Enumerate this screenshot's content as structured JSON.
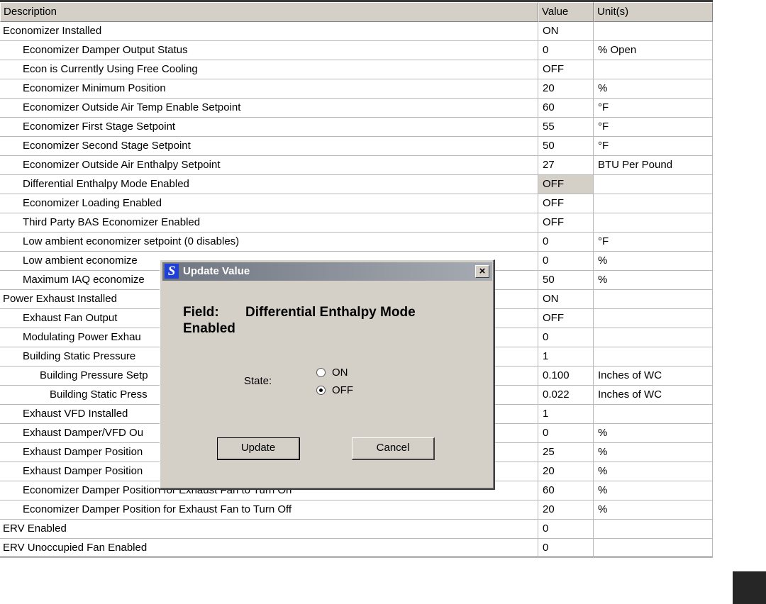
{
  "table": {
    "headers": [
      "Description",
      "Value",
      "Unit(s)"
    ],
    "rows": [
      {
        "desc": "Economizer Installed",
        "indent": 0,
        "value": "ON",
        "unit": ""
      },
      {
        "desc": "Economizer Damper Output Status",
        "indent": 1,
        "value": "0",
        "unit": "% Open"
      },
      {
        "desc": "Econ is Currently Using Free Cooling",
        "indent": 1,
        "value": "OFF",
        "unit": ""
      },
      {
        "desc": "Economizer Minimum Position",
        "indent": 1,
        "value": "20",
        "unit": "%"
      },
      {
        "desc": "Economizer Outside Air Temp Enable Setpoint",
        "indent": 1,
        "value": "60",
        "unit": "°F"
      },
      {
        "desc": "Economizer First Stage Setpoint",
        "indent": 1,
        "value": "55",
        "unit": "°F"
      },
      {
        "desc": "Economizer Second Stage Setpoint",
        "indent": 1,
        "value": "50",
        "unit": "°F"
      },
      {
        "desc": "Economizer Outside Air Enthalpy Setpoint",
        "indent": 1,
        "value": "27",
        "unit": "BTU Per Pound"
      },
      {
        "desc": "Differential Enthalpy Mode Enabled",
        "indent": 1,
        "value": "OFF",
        "unit": "",
        "selected": true
      },
      {
        "desc": "Economizer Loading Enabled",
        "indent": 1,
        "value": "OFF",
        "unit": ""
      },
      {
        "desc": "Third Party BAS Economizer Enabled",
        "indent": 1,
        "value": "OFF",
        "unit": ""
      },
      {
        "desc": "Low ambient economizer setpoint (0 disables)",
        "indent": 1,
        "value": "0",
        "unit": "°F"
      },
      {
        "desc": "Low ambient economize",
        "indent": 1,
        "value": "0",
        "unit": "%"
      },
      {
        "desc": "Maximum IAQ economize",
        "indent": 1,
        "value": "50",
        "unit": "%"
      },
      {
        "desc": "Power Exhaust Installed",
        "indent": 0,
        "value": "ON",
        "unit": ""
      },
      {
        "desc": "Exhaust Fan Output",
        "indent": 1,
        "value": "OFF",
        "unit": ""
      },
      {
        "desc": "Modulating Power Exhau",
        "indent": 1,
        "value": "0",
        "unit": ""
      },
      {
        "desc": "Building Static Pressure",
        "indent": 1,
        "value": "1",
        "unit": ""
      },
      {
        "desc": "Building Pressure Setp",
        "indent": 2,
        "value": "0.100",
        "unit": "Inches of WC"
      },
      {
        "desc": "Building Static Press",
        "indent": 3,
        "value": "0.022",
        "unit": "Inches of WC"
      },
      {
        "desc": "Exhaust VFD Installed",
        "indent": 1,
        "value": "1",
        "unit": ""
      },
      {
        "desc": "Exhaust Damper/VFD Ou",
        "indent": 1,
        "value": "0",
        "unit": "%"
      },
      {
        "desc": "Exhaust Damper Position",
        "indent": 1,
        "value": "25",
        "unit": "%"
      },
      {
        "desc": "Exhaust Damper Position",
        "indent": 1,
        "value": "20",
        "unit": "%"
      },
      {
        "desc": "Economizer Damper Position for Exhaust Fan to Turn On",
        "indent": 1,
        "value": "60",
        "unit": "%"
      },
      {
        "desc": "Economizer Damper Position for Exhaust Fan to Turn Off",
        "indent": 1,
        "value": "20",
        "unit": "%"
      },
      {
        "desc": "ERV Enabled",
        "indent": 0,
        "value": "0",
        "unit": ""
      },
      {
        "desc": "ERV Unoccupied Fan Enabled",
        "indent": 0,
        "value": "0",
        "unit": ""
      }
    ]
  },
  "dialog": {
    "title": "Update Value",
    "logo_letter": "S",
    "close_glyph": "×",
    "field_label": "Field:",
    "field_value": "Differential Enthalpy Mode Enabled",
    "state_label": "State:",
    "options": [
      {
        "label": "ON",
        "checked": false
      },
      {
        "label": "OFF",
        "checked": true
      }
    ],
    "update_label": "Update",
    "cancel_label": "Cancel"
  },
  "colors": {
    "face": "#d4d0c8",
    "title_start": "#6f7681",
    "title_end": "#a7abb3",
    "logo_blue": "#1f3fd6"
  }
}
